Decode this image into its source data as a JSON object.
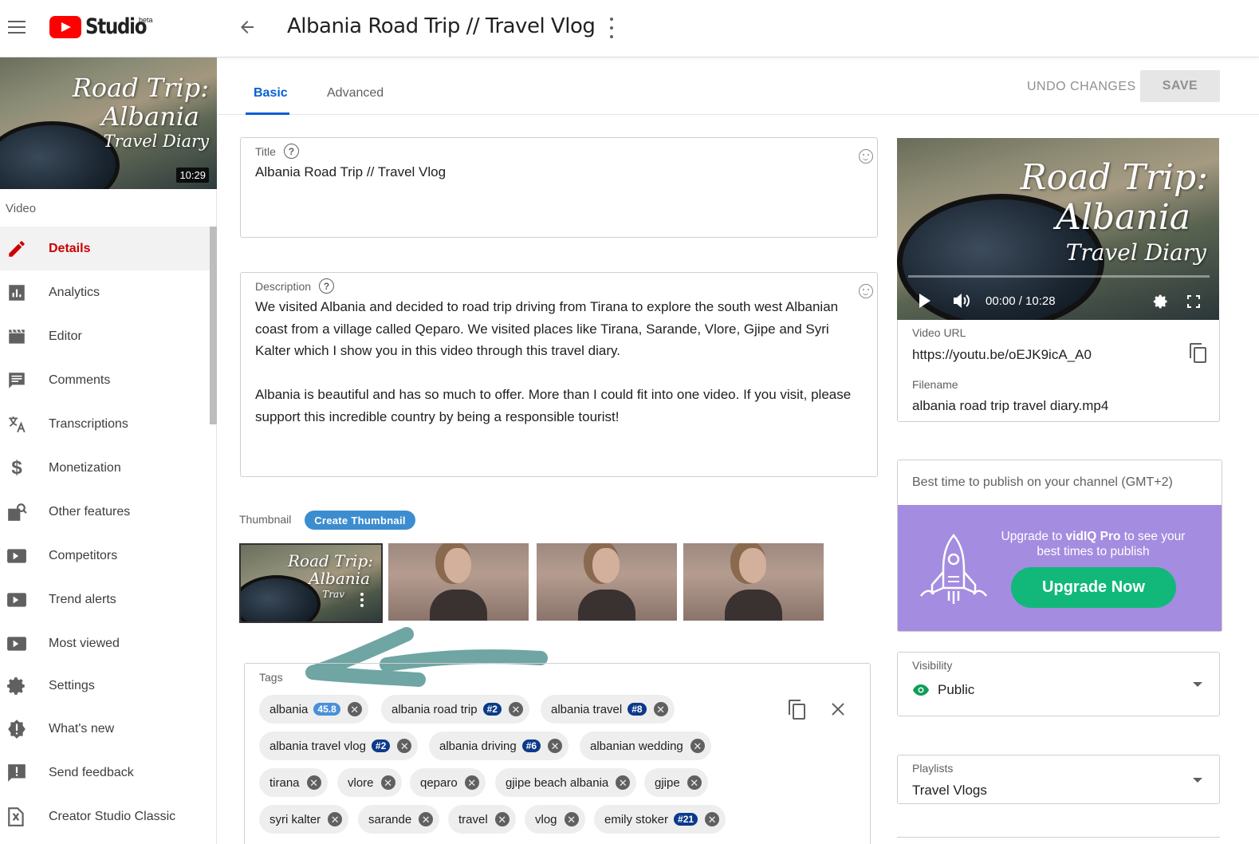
{
  "header": {
    "logo_text": "Studio",
    "logo_badge": "beta",
    "video_title": "Albania Road Trip // Travel Vlog"
  },
  "sidebar": {
    "thumb_text": [
      "Road Trip:",
      "Albania",
      "Travel Diary"
    ],
    "duration": "10:29",
    "section": "Video",
    "items": [
      {
        "label": "Details",
        "icon": "pencil-icon"
      },
      {
        "label": "Analytics",
        "icon": "analytics-icon"
      },
      {
        "label": "Editor",
        "icon": "clapper-icon"
      },
      {
        "label": "Comments",
        "icon": "comment-icon"
      },
      {
        "label": "Transcriptions",
        "icon": "translate-icon"
      },
      {
        "label": "Monetization",
        "icon": "dollar-icon"
      },
      {
        "label": "Other features",
        "icon": "other-features-icon"
      },
      {
        "label": "Competitors",
        "icon": "vidiq-icon"
      },
      {
        "label": "Trend alerts",
        "icon": "vidiq-icon"
      },
      {
        "label": "Most viewed",
        "icon": "vidiq-icon"
      },
      {
        "label": "Settings",
        "icon": "gear-icon"
      },
      {
        "label": "What's new",
        "icon": "badge-alert-icon"
      },
      {
        "label": "Send feedback",
        "icon": "feedback-icon"
      },
      {
        "label": "Creator Studio Classic",
        "icon": "classic-icon"
      }
    ]
  },
  "tabs": {
    "basic": "Basic",
    "advanced": "Advanced",
    "undo": "UNDO CHANGES",
    "save": "SAVE"
  },
  "title_field": {
    "label": "Title",
    "help": "?",
    "value": "Albania Road Trip // Travel Vlog"
  },
  "description_field": {
    "label": "Description",
    "help": "?",
    "lines": [
      "We visited Albania and decided to road trip driving from Tirana to explore the south west Albanian",
      "coast from a village called Qeparo. We visited places like Tirana, Sarande, Vlore, Gjipe and Syri",
      "Kalter which I show you in this video through this travel diary.",
      "",
      "Albania is beautiful and has so much to offer. More than I could fit into one video. If you visit, please",
      "support this incredible country by being a responsible tourist!"
    ]
  },
  "thumbnail": {
    "label": "Thumbnail",
    "create_button": "Create Thumbnail",
    "selected_text": [
      "Road Trip:",
      "Albania",
      "Trav"
    ]
  },
  "tags": {
    "label": "Tags",
    "chips": [
      {
        "text": "albania",
        "badge": "45.8",
        "badge_style": "light"
      },
      {
        "text": "albania road trip",
        "badge": "#2"
      },
      {
        "text": "albania travel",
        "badge": "#8"
      },
      {
        "text": "albania travel vlog",
        "badge": "#2"
      },
      {
        "text": "albania driving",
        "badge": "#6"
      },
      {
        "text": "albanian wedding",
        "badge": ""
      },
      {
        "text": "tirana",
        "badge": ""
      },
      {
        "text": "vlore",
        "badge": ""
      },
      {
        "text": "qeparo",
        "badge": ""
      },
      {
        "text": "gjipe beach albania",
        "badge": ""
      },
      {
        "text": "gjipe",
        "badge": ""
      },
      {
        "text": "syri kalter",
        "badge": ""
      },
      {
        "text": "sarande",
        "badge": ""
      },
      {
        "text": "travel",
        "badge": ""
      },
      {
        "text": "vlog",
        "badge": ""
      },
      {
        "text": "emily stoker",
        "badge": "#21"
      }
    ],
    "remove_glyph": "✕"
  },
  "player": {
    "thumb_text": [
      "Road Trip:",
      "Albania",
      "Travel Diary"
    ],
    "time": "00:00 / 10:28",
    "progress": 0
  },
  "video_info": {
    "url_label": "Video URL",
    "url": "https://youtu.be/oEJK9icA_A0",
    "filename_label": "Filename",
    "filename": "albania road trip travel diary.mp4"
  },
  "best_time": {
    "label": "Best time to publish on your channel (GMT+2)",
    "upgrade_prefix": "Upgrade to ",
    "upgrade_brand": "vidIQ Pro",
    "upgrade_suffix": " to see your",
    "upgrade_line2": "best times to publish",
    "button": "Upgrade Now"
  },
  "visibility": {
    "label": "Visibility",
    "value": "Public"
  },
  "playlists": {
    "label": "Playlists",
    "value": "Travel Vlogs"
  },
  "colors": {
    "accent_blue": "#065fd4",
    "active_red": "#cc0000",
    "upgrade_purple": "#a48ce0",
    "upgrade_green": "#11b87a",
    "arrow_teal": "#6fa5a3"
  }
}
